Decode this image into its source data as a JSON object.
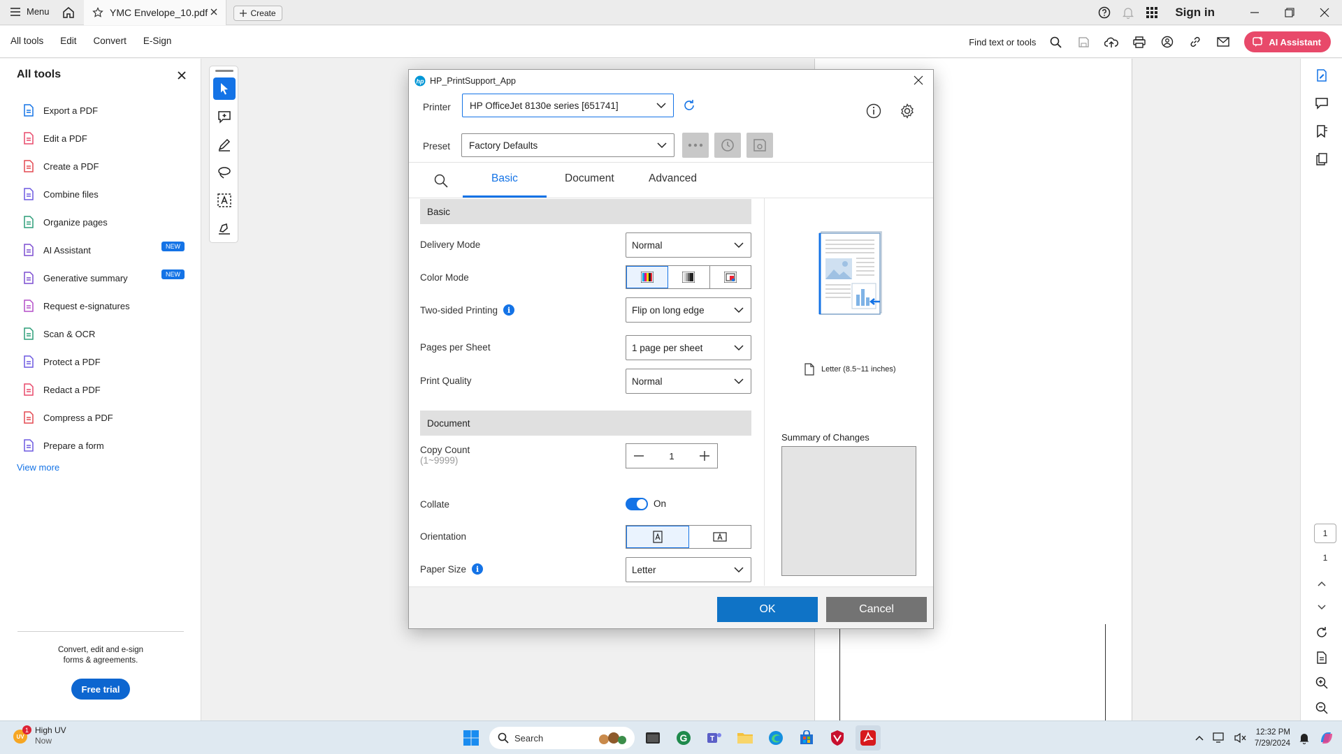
{
  "titlebar": {
    "menu_label": "Menu",
    "tab_title": "YMC Envelope_10.pdf",
    "create_label": "Create",
    "sign_in": "Sign in"
  },
  "menubar": {
    "items": [
      "All tools",
      "Edit",
      "Convert",
      "E-Sign"
    ],
    "find_text": "Find text or tools",
    "ai_assistant": "AI Assistant"
  },
  "left_panel": {
    "title": "All tools",
    "tools": [
      {
        "label": "Export a PDF",
        "icon": "export-pdf-icon",
        "color": "#1473e6"
      },
      {
        "label": "Edit a PDF",
        "icon": "edit-pdf-icon",
        "color": "#e8496a"
      },
      {
        "label": "Create a PDF",
        "icon": "create-pdf-icon",
        "color": "#e34850"
      },
      {
        "label": "Combine files",
        "icon": "combine-files-icon",
        "color": "#6d59e0"
      },
      {
        "label": "Organize pages",
        "icon": "organize-pages-icon",
        "color": "#2d9d78"
      },
      {
        "label": "AI Assistant",
        "icon": "ai-assistant-icon",
        "color": "#7c4dd1",
        "badge": "NEW"
      },
      {
        "label": "Generative summary",
        "icon": "generative-summary-icon",
        "color": "#7c4dd1",
        "badge": "NEW"
      },
      {
        "label": "Request e-signatures",
        "icon": "request-esignatures-icon",
        "color": "#b44fc8"
      },
      {
        "label": "Scan & OCR",
        "icon": "scan-ocr-icon",
        "color": "#2d9d78"
      },
      {
        "label": "Protect a PDF",
        "icon": "protect-pdf-icon",
        "color": "#6d59e0"
      },
      {
        "label": "Redact a PDF",
        "icon": "redact-pdf-icon",
        "color": "#e8496a"
      },
      {
        "label": "Compress a PDF",
        "icon": "compress-pdf-icon",
        "color": "#e34850"
      },
      {
        "label": "Prepare a form",
        "icon": "prepare-form-icon",
        "color": "#6d59e0"
      }
    ],
    "view_more": "View more",
    "promo_line1": "Convert, edit and e-sign",
    "promo_line2": "forms & agreements.",
    "free_trial": "Free trial"
  },
  "dialog": {
    "title": "HP_PrintSupport_App",
    "printer_label": "Printer",
    "printer_value": "HP OfficeJet 8130e series [651741]",
    "preset_label": "Preset",
    "preset_value": "Factory Defaults",
    "tabs": [
      "Basic",
      "Document",
      "Advanced"
    ],
    "active_tab": "Basic",
    "section_basic": "Basic",
    "delivery_mode_label": "Delivery Mode",
    "delivery_mode_value": "Normal",
    "color_mode_label": "Color Mode",
    "two_sided_label": "Two-sided Printing",
    "two_sided_value": "Flip on long edge",
    "pages_per_sheet_label": "Pages per Sheet",
    "pages_per_sheet_value": "1 page per sheet",
    "print_quality_label": "Print Quality",
    "print_quality_value": "Normal",
    "section_document": "Document",
    "copy_count_label": "Copy Count",
    "copy_count_range": "(1~9999)",
    "copy_count_value": "1",
    "collate_label": "Collate",
    "collate_value": "On",
    "orientation_label": "Orientation",
    "paper_size_label": "Paper Size",
    "paper_size_value": "Letter",
    "paper_preview_label": "Letter (8.5~11 inches)",
    "summary_label": "Summary of Changes",
    "ok": "OK",
    "cancel": "Cancel"
  },
  "right_rail": {
    "current_page": "1",
    "total_pages": "1"
  },
  "taskbar": {
    "weather_title": "High UV",
    "weather_sub": "Now",
    "weather_badge": "1",
    "search_placeholder": "Search",
    "time": "12:32 PM",
    "date": "7/29/2024"
  },
  "colors": {
    "accent": "#1473e6",
    "ai_button": "#e8496a",
    "ok_button": "#0f73c6",
    "cancel_button": "#737373"
  }
}
